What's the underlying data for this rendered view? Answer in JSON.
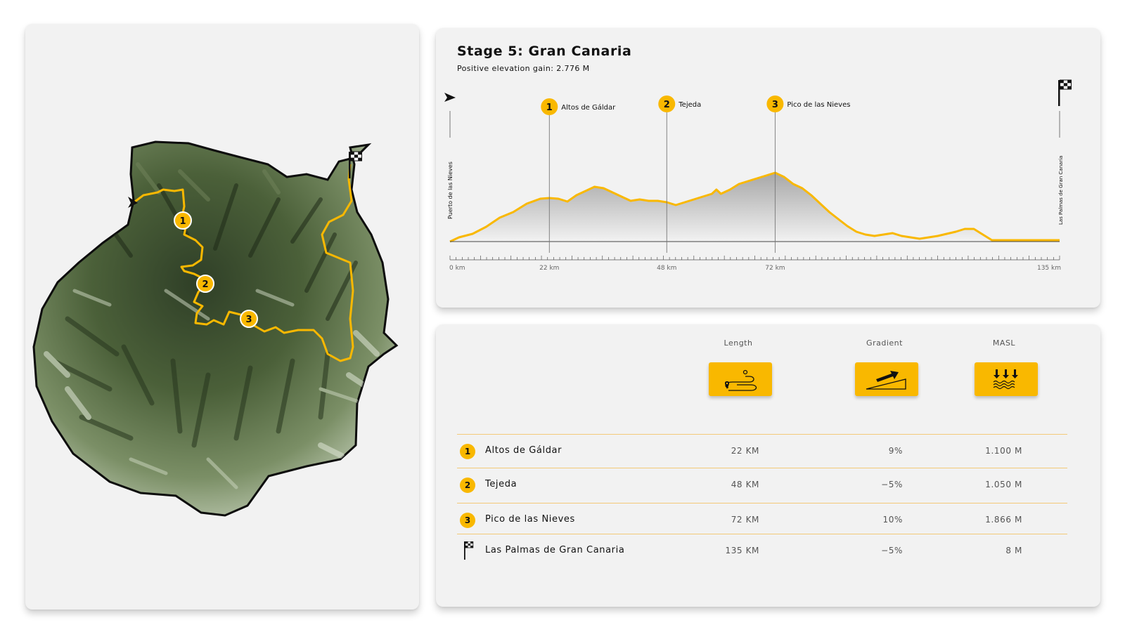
{
  "profile": {
    "title": "Stage 5: Gran Canaria",
    "subtitle": "Positive elevation gain: 2.776 M",
    "start_label": "Puerto de las Nieves",
    "end_label": "Las Palmas de Gran Canaria",
    "x_ticks": [
      {
        "km": 0,
        "label": "0 km"
      },
      {
        "km": 22,
        "label": "22 km"
      },
      {
        "km": 48,
        "label": "48 km"
      },
      {
        "km": 72,
        "label": "72 km"
      },
      {
        "km": 135,
        "label": "135 km"
      }
    ],
    "waypoints": [
      {
        "num": "1",
        "name": "Altos de Gáldar",
        "km": 22
      },
      {
        "num": "2",
        "name": "Tejeda",
        "km": 48
      },
      {
        "num": "3",
        "name": "Pico de las Nieves",
        "km": 72
      }
    ],
    "colors": {
      "route": "#f9b800",
      "badge": "#f9b800"
    }
  },
  "table": {
    "headers": {
      "length": "Length",
      "gradient": "Gradient",
      "masl": "MASL"
    },
    "icons": {
      "length": "route-pin-icon",
      "gradient": "slope-arrow-icon",
      "masl": "sea-level-icon"
    },
    "rows": [
      {
        "num": "1",
        "name": "Altos de Gáldar",
        "length": "22 KM",
        "gradient": "9%",
        "masl": "1.100 M"
      },
      {
        "num": "2",
        "name": "Tejeda",
        "length": "48 KM",
        "gradient": "−5%",
        "masl": "1.050 M"
      },
      {
        "num": "3",
        "name": "Pico de las Nieves",
        "length": "72 KM",
        "gradient": "10%",
        "masl": "1.866 M"
      },
      {
        "num": "",
        "name": "Las Palmas de Gran Canaria",
        "length": "135 KM",
        "gradient": "−5%",
        "masl": "8 M"
      }
    ]
  },
  "map": {
    "markers": [
      "1",
      "2",
      "3"
    ],
    "colors": {
      "terrain_dark": "#3e5130",
      "terrain_light": "#a8b79a",
      "route": "#f9b800"
    }
  }
}
